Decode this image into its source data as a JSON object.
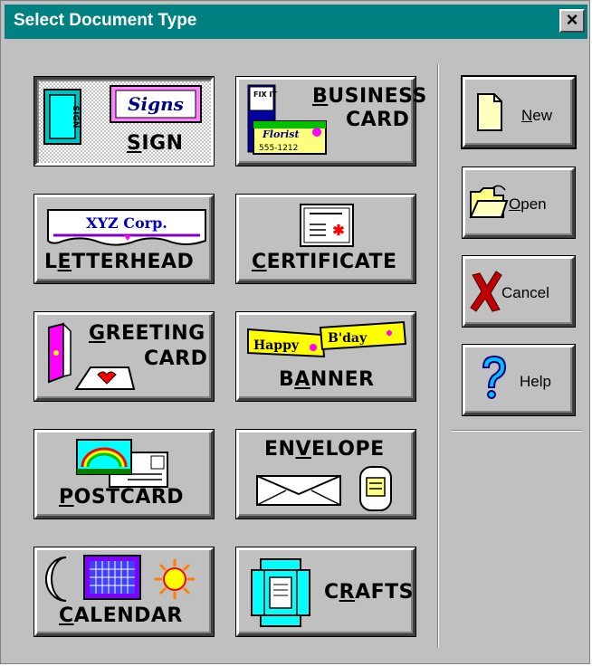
{
  "window": {
    "title": "Select Document Type",
    "close_glyph": "×"
  },
  "doc_types": {
    "sign": {
      "label_a": "S",
      "label_b": "IGN",
      "art_text": "Signs",
      "art_small": "SIGN"
    },
    "business_card": {
      "line1_a": "B",
      "line1_b": "USINESS",
      "line2": "CARD",
      "art_fix": "FIX IT",
      "art_florist": "Florist",
      "art_phone": "555-1212"
    },
    "letterhead": {
      "label_a": "L",
      "label_b": "E",
      "label_c": "TTERHEAD",
      "art_text": "XYZ Corp."
    },
    "certificate": {
      "label_a": "C",
      "label_b": "ERTIFICATE"
    },
    "greeting_card": {
      "line1_a": "G",
      "line1_b": "REETING",
      "line2": "CARD"
    },
    "banner": {
      "label_a": "B",
      "label_b": "A",
      "label_c": "NNER",
      "art_happy": "Happy",
      "art_bday": "B'day"
    },
    "postcard": {
      "label_a": "P",
      "label_b": "OSTCARD"
    },
    "envelope": {
      "label_a": "EN",
      "label_b": "V",
      "label_c": "ELOPE"
    },
    "calendar": {
      "label_a": "C",
      "label_b": "ALENDAR"
    },
    "crafts": {
      "label_a": "C",
      "label_b": "R",
      "label_c": "AFTS"
    }
  },
  "side_buttons": {
    "new": {
      "a": "N",
      "b": "ew"
    },
    "open": {
      "a": "O",
      "b": "pen"
    },
    "cancel": {
      "label": "Cancel"
    },
    "help": {
      "label": "Help"
    }
  },
  "colors": {
    "titlebar": "#008080",
    "face": "#c0c0c0",
    "cancel_x": "#c00000",
    "help_q": "#0000c0"
  }
}
